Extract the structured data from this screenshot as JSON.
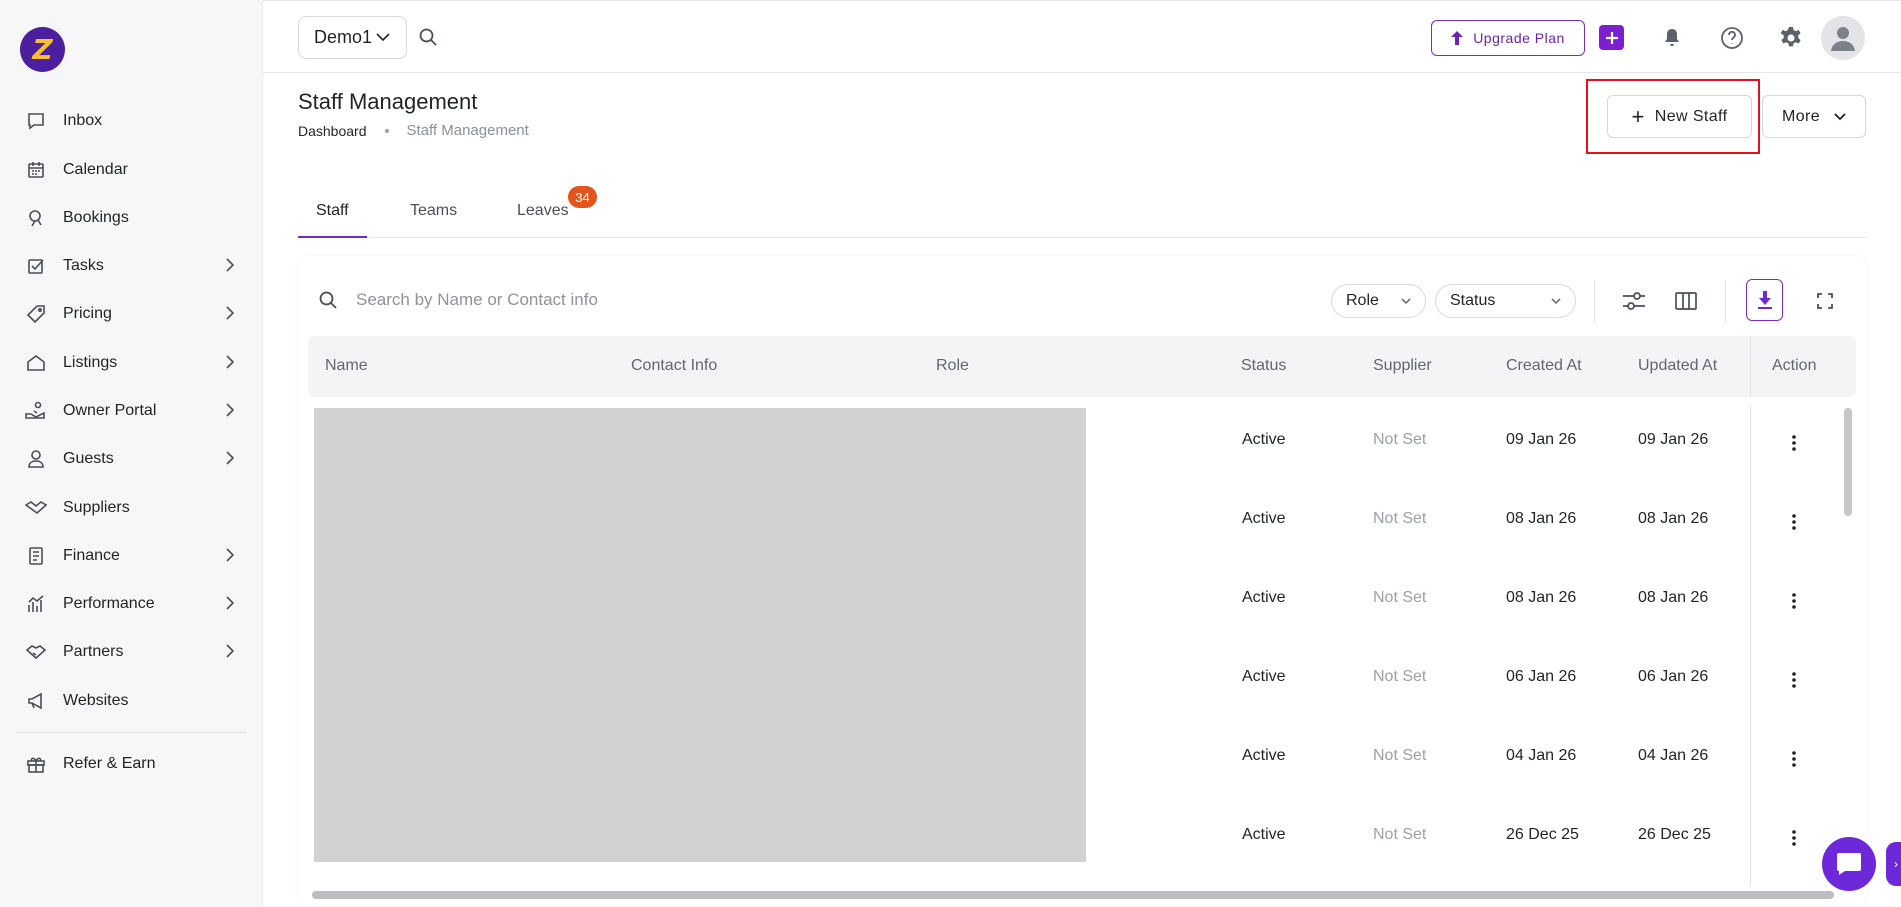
{
  "brand": {
    "logo_letter": "Z",
    "logo_bg": "#4b1f9e",
    "logo_fg": "#f6c12a"
  },
  "sidebar": {
    "items": [
      {
        "label": "Inbox",
        "icon": "inbox-icon",
        "has_chevron": false
      },
      {
        "label": "Calendar",
        "icon": "calendar-icon",
        "has_chevron": false
      },
      {
        "label": "Bookings",
        "icon": "bookings-icon",
        "has_chevron": false
      },
      {
        "label": "Tasks",
        "icon": "tasks-icon",
        "has_chevron": true
      },
      {
        "label": "Pricing",
        "icon": "tag-icon",
        "has_chevron": true
      },
      {
        "label": "Listings",
        "icon": "home-icon",
        "has_chevron": true
      },
      {
        "label": "Owner Portal",
        "icon": "owner-icon",
        "has_chevron": true
      },
      {
        "label": "Guests",
        "icon": "guest-icon",
        "has_chevron": true
      },
      {
        "label": "Suppliers",
        "icon": "handshake-icon",
        "has_chevron": false
      },
      {
        "label": "Finance",
        "icon": "finance-icon",
        "has_chevron": true
      },
      {
        "label": "Performance",
        "icon": "chart-icon",
        "has_chevron": true
      },
      {
        "label": "Partners",
        "icon": "partners-icon",
        "has_chevron": true
      },
      {
        "label": "Websites",
        "icon": "megaphone-icon",
        "has_chevron": false
      }
    ],
    "footer_item": {
      "label": "Refer & Earn",
      "icon": "gift-icon"
    }
  },
  "topbar": {
    "account_select": "Demo1",
    "upgrade_label": "Upgrade Plan",
    "accent": "#7b1fd1"
  },
  "page": {
    "title": "Staff Management",
    "breadcrumb": [
      "Dashboard",
      "Staff Management"
    ],
    "new_button": "New Staff",
    "more_button": "More"
  },
  "tabs": [
    {
      "label": "Staff",
      "active": true
    },
    {
      "label": "Teams",
      "active": false
    },
    {
      "label": "Leaves",
      "active": false
    }
  ],
  "leaves_badge": "34",
  "toolbar": {
    "search_placeholder": "Search by Name or Contact info",
    "filters": [
      "Role",
      "Status"
    ]
  },
  "table": {
    "columns": [
      "Name",
      "Contact Info",
      "Role",
      "Status",
      "Supplier",
      "Created At",
      "Updated At",
      "Action"
    ],
    "rows": [
      {
        "status": "Active",
        "supplier": "Not Set",
        "created": "09 Jan 26",
        "updated": "09 Jan 26"
      },
      {
        "status": "Active",
        "supplier": "Not Set",
        "created": "08 Jan 26",
        "updated": "08 Jan 26"
      },
      {
        "status": "Active",
        "supplier": "Not Set",
        "created": "08 Jan 26",
        "updated": "08 Jan 26"
      },
      {
        "status": "Active",
        "supplier": "Not Set",
        "created": "06 Jan 26",
        "updated": "06 Jan 26"
      },
      {
        "status": "Active",
        "supplier": "Not Set",
        "created": "04 Jan 26",
        "updated": "04 Jan 26"
      },
      {
        "status": "Active",
        "supplier": "Not Set",
        "created": "26 Dec 25",
        "updated": "26 Dec 25"
      }
    ]
  }
}
